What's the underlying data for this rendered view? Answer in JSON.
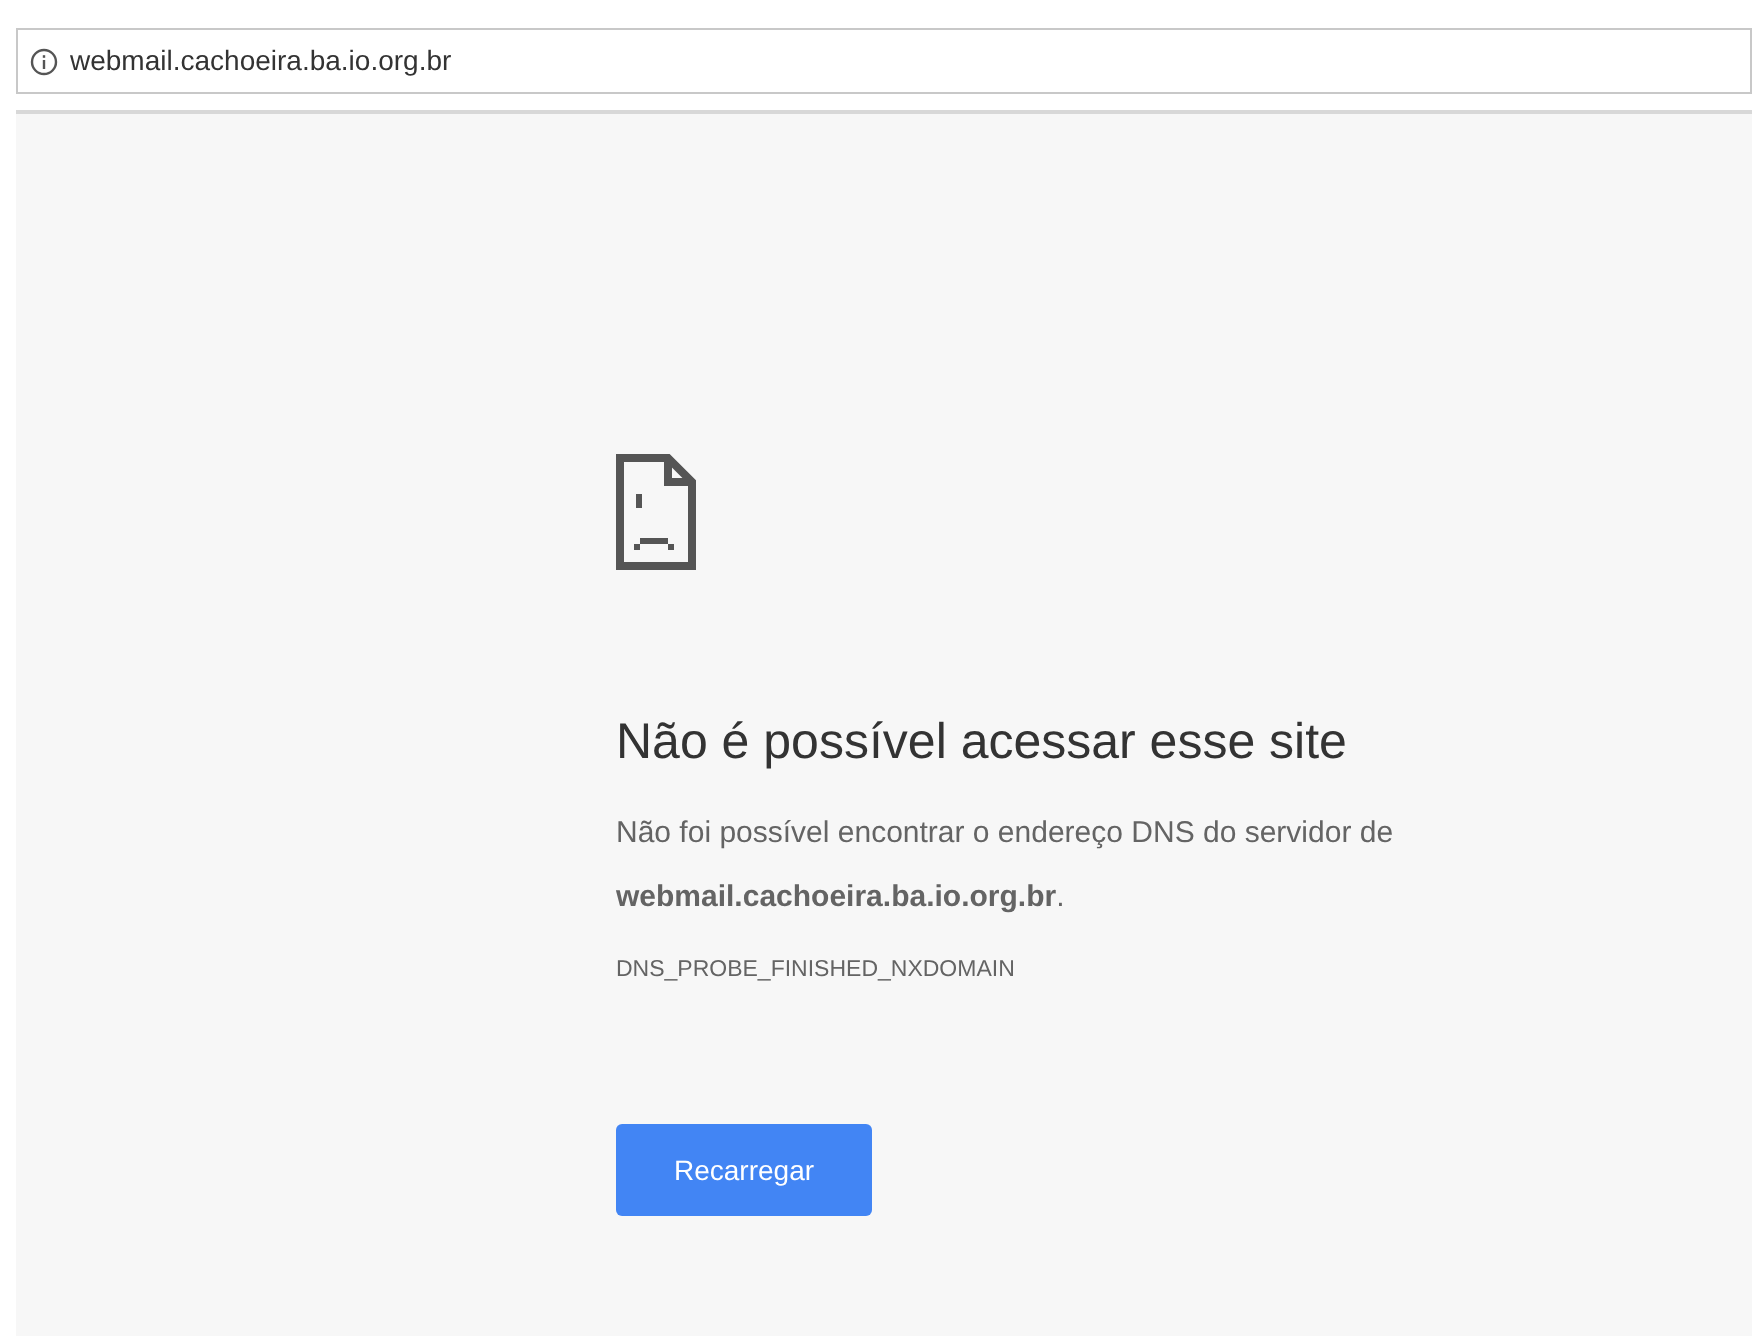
{
  "address_bar": {
    "url": "webmail.cachoeira.ba.io.org.br"
  },
  "error": {
    "title": "Não é possível acessar esse site",
    "message": "Não foi possível encontrar o endereço DNS do servidor de **webmail.cachoeira.ba.io.org.br**.",
    "code": "DNS_PROBE_FINISHED_NXDOMAIN",
    "button": "Recarregar"
  }
}
